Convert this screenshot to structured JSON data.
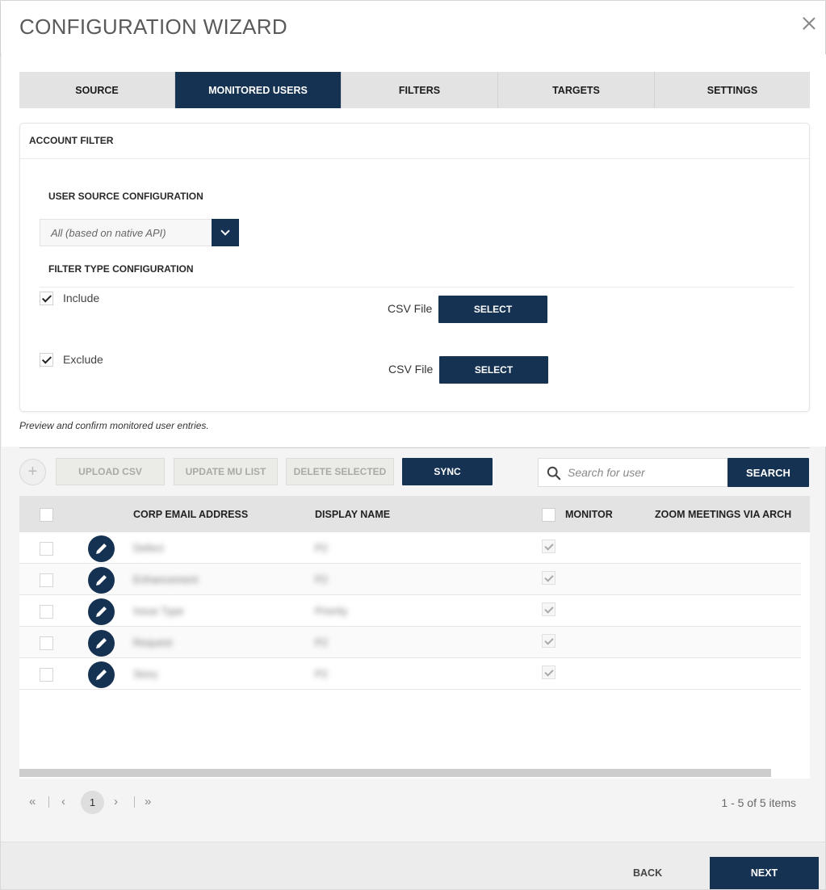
{
  "window": {
    "title": "CONFIGURATION WIZARD",
    "close_icon": "close-icon"
  },
  "tabs": [
    {
      "label": "SOURCE",
      "active": false
    },
    {
      "label": "MONITORED USERS",
      "active": true
    },
    {
      "label": "FILTERS",
      "active": false
    },
    {
      "label": "TARGETS",
      "active": false
    },
    {
      "label": "SETTINGS",
      "active": false
    }
  ],
  "account_filter": {
    "title": "ACCOUNT FILTER",
    "user_source_label": "USER SOURCE CONFIGURATION",
    "user_source_value": "All (based on native API)",
    "filter_type_label": "FILTER TYPE CONFIGURATION",
    "include": {
      "label": "Include",
      "checked": true,
      "csv_label": "CSV File",
      "button": "SELECT"
    },
    "exclude": {
      "label": "Exclude",
      "checked": true,
      "csv_label": "CSV File",
      "button": "SELECT"
    }
  },
  "preview_note": "Preview and confirm monitored user entries.",
  "toolbar": {
    "add_icon": "plus-icon",
    "upload_csv": "UPLOAD CSV",
    "update_mu_list": "UPDATE MU LIST",
    "delete_selected": "DELETE SELECTED",
    "sync": "SYNC",
    "search_placeholder": "Search for user",
    "search_button": "SEARCH"
  },
  "grid": {
    "columns": [
      "CORP EMAIL ADDRESS",
      "DISPLAY NAME",
      "MONITOR",
      "ZOOM MEETINGS VIA ARCH"
    ],
    "rows": [
      {
        "email": "Defect",
        "name": "P2",
        "monitor": true
      },
      {
        "email": "Enhancement",
        "name": "P2",
        "monitor": true
      },
      {
        "email": "Issue Type",
        "name": "Priority",
        "monitor": true
      },
      {
        "email": "Request",
        "name": "P2",
        "monitor": true
      },
      {
        "email": "Story",
        "name": "P2",
        "monitor": true
      }
    ]
  },
  "pager": {
    "current_page": "1",
    "info": "1 - 5 of 5 items"
  },
  "footer": {
    "back": "BACK",
    "next": "NEXT"
  },
  "colors": {
    "primary": "#163253",
    "tab_bg": "#e3e3e3",
    "disabled_btn": "#ebebe8"
  }
}
